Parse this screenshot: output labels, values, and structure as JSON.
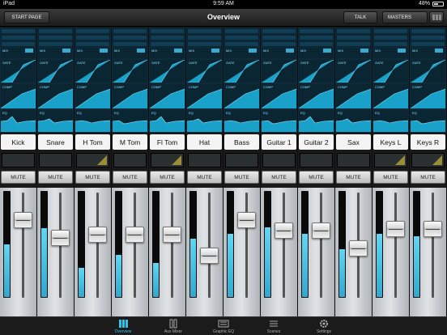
{
  "status": {
    "device": "iPad",
    "time": "9:59 AM",
    "battery": "48%"
  },
  "nav": {
    "start_page": "START PAGE",
    "title": "Overview",
    "talk": "TALK",
    "masters": "MASTERS"
  },
  "mute_label": "MUTE",
  "section_labels": {
    "gate": "GATE",
    "comp": "COMP",
    "eq": "EQ",
    "mix": "MIX"
  },
  "channels": [
    {
      "name": "Kick",
      "meter": 0.5,
      "fader": 0.78
    },
    {
      "name": "Snare",
      "meter": 0.65,
      "fader": 0.58
    },
    {
      "name": "H Tom",
      "meter": 0.28,
      "fader": 0.62
    },
    {
      "name": "M Tom",
      "meter": 0.4,
      "fader": 0.62
    },
    {
      "name": "Fl Tom",
      "meter": 0.32,
      "fader": 0.62
    },
    {
      "name": "Hat",
      "meter": 0.55,
      "fader": 0.38
    },
    {
      "name": "Bass",
      "meter": 0.6,
      "fader": 0.78
    },
    {
      "name": "Guitar 1",
      "meter": 0.66,
      "fader": 0.66
    },
    {
      "name": "Guitar 2",
      "meter": 0.6,
      "fader": 0.66
    },
    {
      "name": "Sax",
      "meter": 0.45,
      "fader": 0.46
    },
    {
      "name": "Keys L",
      "meter": 0.6,
      "fader": 0.68
    },
    {
      "name": "Keys R",
      "meter": 0.58,
      "fader": 0.68
    }
  ],
  "tabs": [
    {
      "label": "Overview",
      "icon": "overview-icon",
      "active": true
    },
    {
      "label": "Aux Mixer",
      "icon": "aux-mixer-icon",
      "active": false
    },
    {
      "label": "Graphic EQ",
      "icon": "graphic-eq-icon",
      "active": false
    },
    {
      "label": "Scenes",
      "icon": "scenes-icon",
      "active": false
    },
    {
      "label": "Settings",
      "icon": "gear-icon",
      "active": false
    }
  ],
  "colors": {
    "accent": "#2fc4e8",
    "routing_bg": "#0f2a38",
    "meter": "#3cb9dd"
  }
}
